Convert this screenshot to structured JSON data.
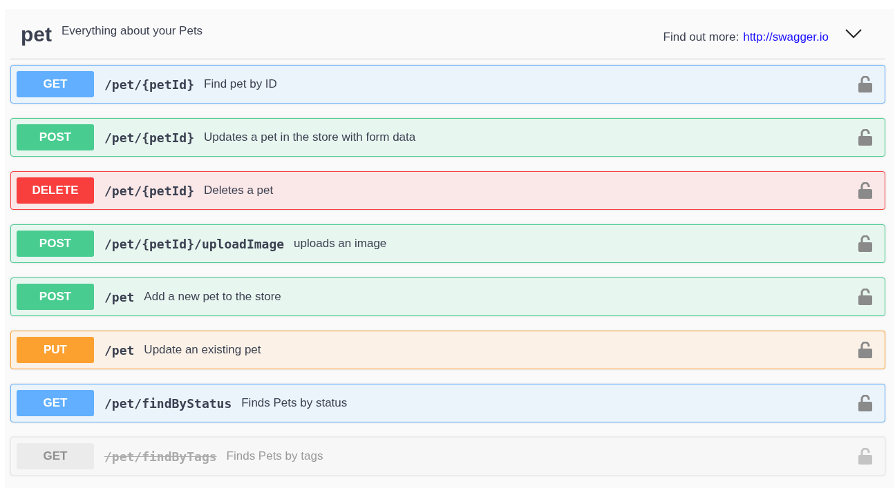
{
  "tag": {
    "name": "pet",
    "description": "Everything about your Pets",
    "more_label": "Find out more:",
    "more_link": "http://swagger.io",
    "expanded": true
  },
  "operations": [
    {
      "method": "GET",
      "path": "/pet/{petId}",
      "summary": "Find pet by ID",
      "deprecated": false
    },
    {
      "method": "POST",
      "path": "/pet/{petId}",
      "summary": "Updates a pet in the store with form data",
      "deprecated": false
    },
    {
      "method": "DELETE",
      "path": "/pet/{petId}",
      "summary": "Deletes a pet",
      "deprecated": false
    },
    {
      "method": "POST",
      "path": "/pet/{petId}/uploadImage",
      "summary": "uploads an image",
      "deprecated": false
    },
    {
      "method": "POST",
      "path": "/pet",
      "summary": "Add a new pet to the store",
      "deprecated": false
    },
    {
      "method": "PUT",
      "path": "/pet",
      "summary": "Update an existing pet",
      "deprecated": false
    },
    {
      "method": "GET",
      "path": "/pet/findByStatus",
      "summary": "Finds Pets by status",
      "deprecated": false
    },
    {
      "method": "GET",
      "path": "/pet/findByTags",
      "summary": "Finds Pets by tags",
      "deprecated": true
    }
  ]
}
